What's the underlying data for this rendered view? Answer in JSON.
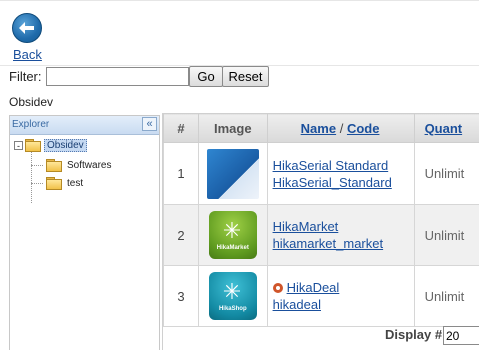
{
  "toolbar": {
    "back_label": "Back"
  },
  "filter": {
    "label": "Filter:",
    "value": "",
    "go_label": "Go",
    "reset_label": "Reset"
  },
  "category_title": "Obsidev",
  "explorer": {
    "title": "Explorer",
    "collapse_symbol": "«",
    "root": {
      "toggle": "-",
      "label": "Obsidev"
    },
    "children": [
      {
        "label": "Softwares"
      },
      {
        "label": "test"
      }
    ]
  },
  "table": {
    "headers": {
      "num": "#",
      "image": "Image",
      "name": "Name",
      "separator": " / ",
      "code": "Code",
      "quantity": "Quant"
    },
    "rows": [
      {
        "num": "1",
        "name": "HikaSerial Standard",
        "code": "HikaSerial_Standard",
        "quantity": "Unlimit",
        "image": "hikaserial-box"
      },
      {
        "num": "2",
        "name": "HikaMarket",
        "code": "hikamarket_market",
        "quantity": "Unlimit",
        "image": "hikamarket-logo"
      },
      {
        "num": "3",
        "name": "HikaDeal",
        "code": "hikadeal",
        "quantity": "Unlimit",
        "image": "hikashop-logo"
      }
    ]
  },
  "thumb_text": {
    "market": "HikaMarket",
    "shop": "HikaShop"
  },
  "footer": {
    "display_label": "Display #",
    "display_value": "20"
  },
  "colors": {
    "link": "#1a4f9c",
    "status_dot": "#d0552a"
  }
}
